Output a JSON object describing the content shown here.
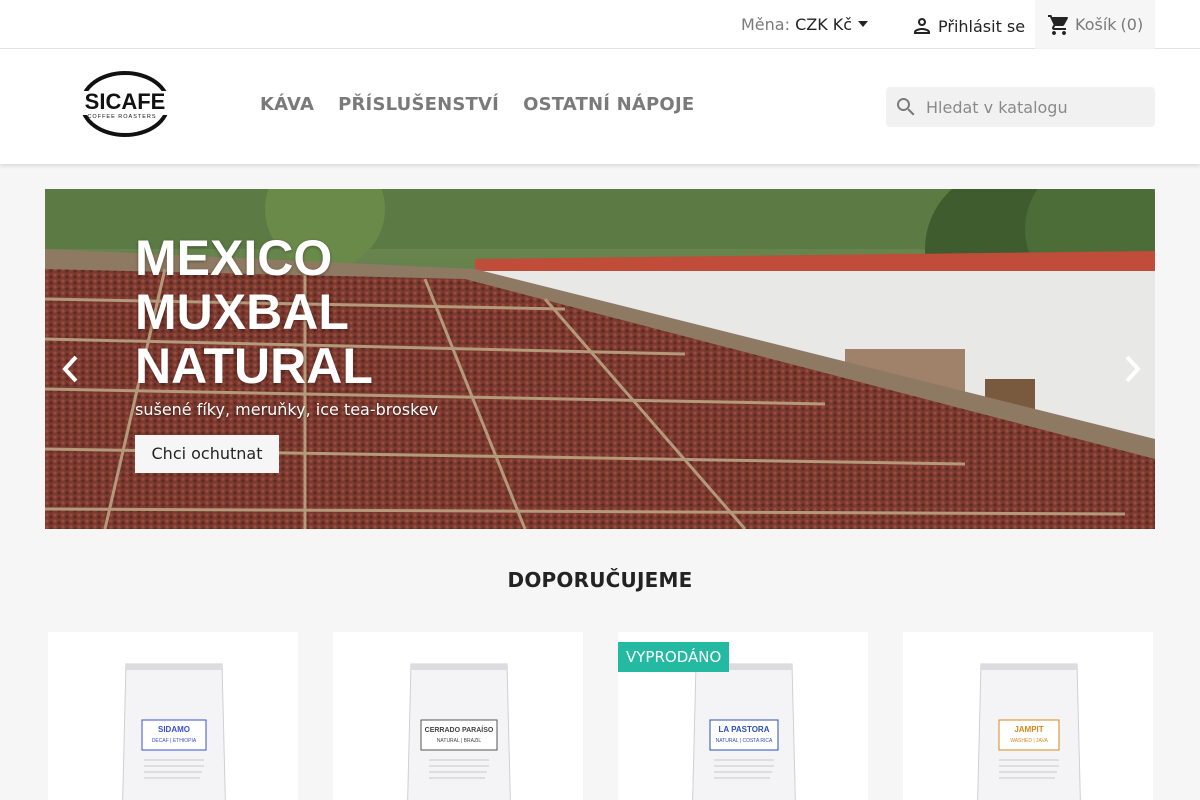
{
  "topbar": {
    "currency_label": "Měna:",
    "currency_value": "CZK Kč",
    "login_label": "Přihlásit se",
    "cart_label": "Košík",
    "cart_count": "(0)"
  },
  "header": {
    "logo_text": "SICAFE",
    "logo_sub": "COFFEE ROASTERS",
    "nav": [
      "KÁVA",
      "PŘÍSLUŠENSTVÍ",
      "OSTATNÍ NÁPOJE"
    ],
    "search_placeholder": "Hledat v katalogu"
  },
  "slider": {
    "title": "MEXICO MUXBAL NATURAL",
    "subtitle": "sušené fíky, meruňky, ice tea-broskev",
    "button_label": "Chci ochutnat"
  },
  "featured": {
    "title": "DOPORUČUJEME",
    "products": [
      {
        "name": "SIDAMO",
        "sub": "DECAF | ETHIOPIA",
        "accent": "#3a4fd6"
      },
      {
        "name": "CERRADO PARAÍSO",
        "sub": "NATURAL | BRAZIL",
        "accent": "#555555"
      },
      {
        "name": "LA PASTORA",
        "sub": "NATURAL | COSTA RICA",
        "accent": "#2a4fb8"
      },
      {
        "name": "JAMPIT",
        "sub": "WASHED | JAVA",
        "accent": "#d58a1a"
      }
    ],
    "sold_out_label": "VYPRODÁNO"
  },
  "colors": {
    "accent": "#24b9a1",
    "nav_text": "#7a7a7a",
    "background": "#f6f6f6"
  }
}
